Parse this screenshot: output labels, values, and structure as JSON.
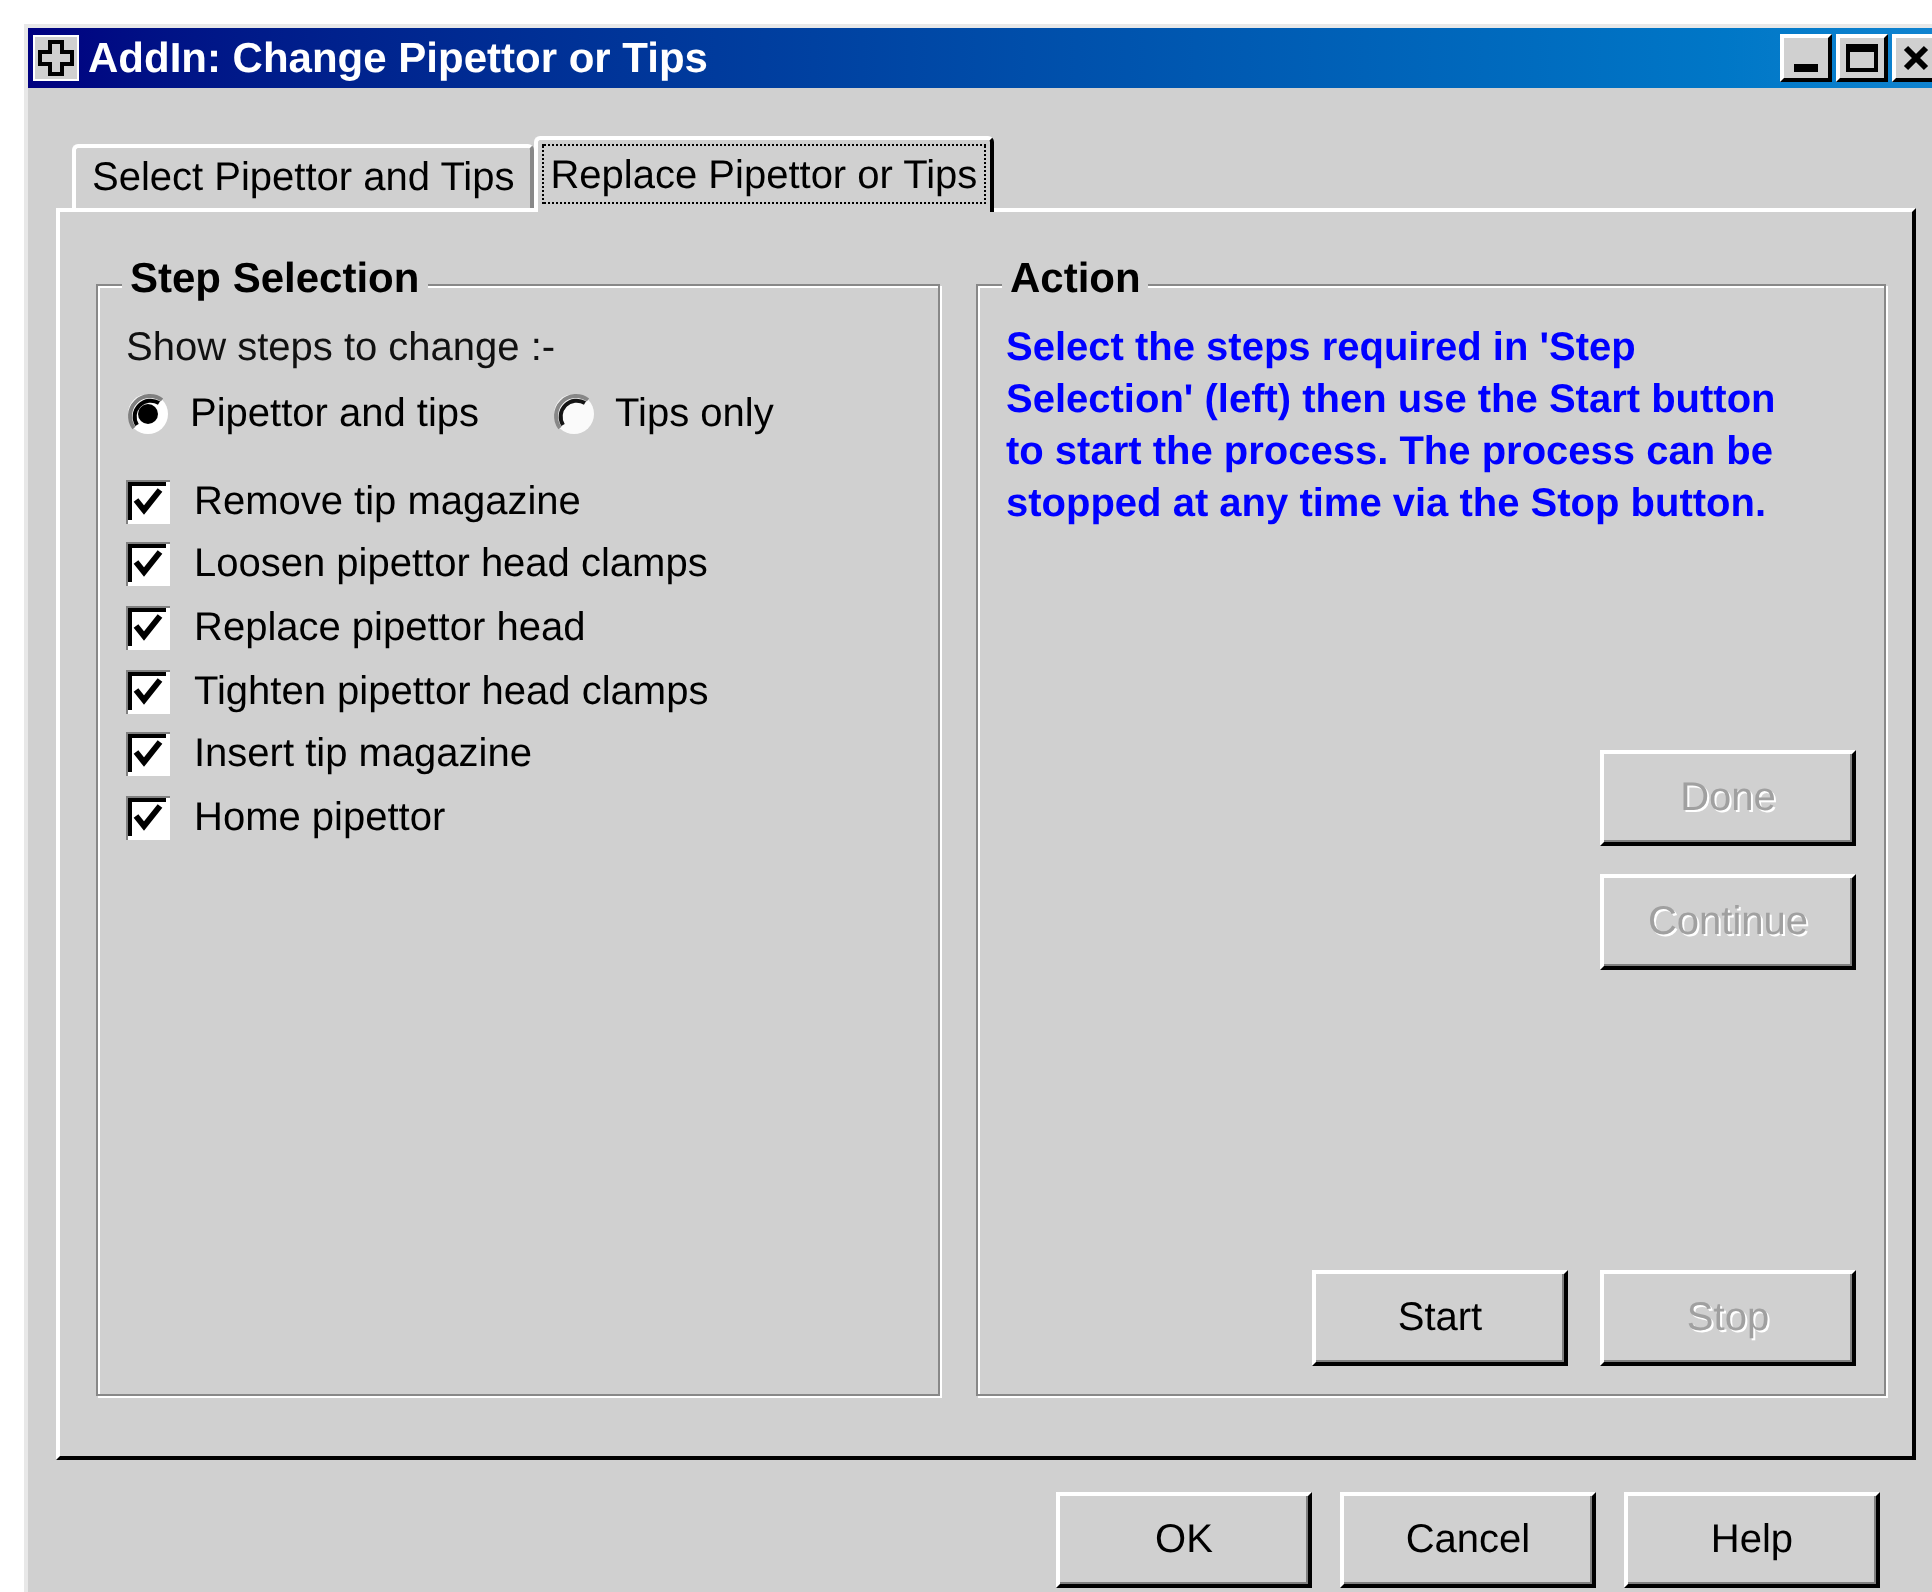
{
  "window": {
    "title": "AddIn: Change Pipettor or Tips"
  },
  "tabs": [
    {
      "label": "Select Pipettor and Tips",
      "selected": false
    },
    {
      "label": "Replace Pipettor or Tips",
      "selected": true
    }
  ],
  "step_selection": {
    "title": "Step Selection",
    "prompt": "Show steps to change :-",
    "radios": [
      {
        "label": "Pipettor and tips",
        "selected": true
      },
      {
        "label": "Tips only",
        "selected": false
      }
    ],
    "steps": [
      {
        "label": "Remove tip magazine",
        "checked": true
      },
      {
        "label": "Loosen pipettor head clamps",
        "checked": true
      },
      {
        "label": "Replace pipettor head",
        "checked": true
      },
      {
        "label": "Tighten pipettor head clamps",
        "checked": true
      },
      {
        "label": "Insert tip magazine",
        "checked": true
      },
      {
        "label": "Home pipettor",
        "checked": true
      }
    ]
  },
  "action": {
    "title": "Action",
    "message": "Select the steps required in 'Step Selection' (left) then use the Start button to start the process. The process can be stopped at any time via the Stop button.",
    "side_buttons": [
      {
        "label": "Done",
        "disabled": true
      },
      {
        "label": "Continue",
        "disabled": true
      }
    ],
    "bottom_buttons": [
      {
        "label": "Start",
        "disabled": false
      },
      {
        "label": "Stop",
        "disabled": true
      }
    ]
  },
  "dialog_buttons": [
    {
      "label": "OK",
      "disabled": false
    },
    {
      "label": "Cancel",
      "disabled": false
    },
    {
      "label": "Help",
      "disabled": false
    }
  ]
}
